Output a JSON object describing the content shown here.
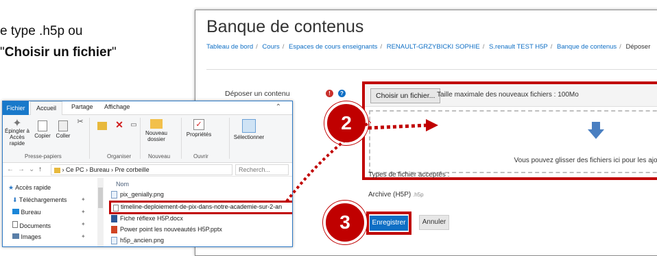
{
  "instructions": {
    "line1": "e type .h5p ou",
    "line2_prefix": "\"",
    "line2_bold": "Choisir un fichier",
    "line2_suffix": "\""
  },
  "moodle": {
    "title": "Banque de contenus",
    "breadcrumb": [
      "Tableau de bord",
      "Cours",
      "Espaces de cours enseignants",
      "RENAULT-GRZYBICKI SOPHIE",
      "S.renault TEST H5P",
      "Banque de contenus",
      "Déposer"
    ],
    "form_label": "Déposer un contenu",
    "choose_button": "Choisir un fichier...",
    "max_size": "Taille maximale des nouveaux fichiers : 100Mo",
    "drop_text": "Vous pouvez glisser des fichiers ici pour les ajouter.",
    "accepted_types_label": "Types de fichier acceptés :",
    "accepted_type": "Archive (H5P)",
    "accepted_ext": ".h5p",
    "save_button": "Enregistrer",
    "cancel_button": "Annuler"
  },
  "badges": {
    "step2": "2",
    "step3": "3"
  },
  "explorer": {
    "tabs": {
      "file": "Fichier",
      "home": "Accueil",
      "share": "Partage",
      "view": "Affichage"
    },
    "ribbon": {
      "pin": "Épingler à Accès rapide",
      "copy": "Copier",
      "paste": "Coller",
      "new_folder": "Nouveau dossier",
      "properties": "Propriétés",
      "select": "Sélectionner",
      "groups": {
        "clipboard": "Presse-papiers",
        "organize": "Organiser",
        "new": "Nouveau",
        "open": "Ouvrir"
      }
    },
    "address": [
      "Ce PC",
      "Bureau",
      "Pre corbeille"
    ],
    "search_placeholder": "Recherch...",
    "nav": [
      "Accès rapide",
      "Téléchargements",
      "Bureau",
      "Documents",
      "Images"
    ],
    "column_name": "Nom",
    "files": [
      "pix_genially.png",
      "timeline-deploiement-de-pix-dans-notre-academie-sur-2-an",
      "Fiche réflexe H5P.docx",
      "Power point les nouveautés H5P.pptx",
      "h5p_ancien.png"
    ]
  },
  "colors": {
    "highlight": "#c00000",
    "link": "#0f6fc5",
    "explorer_accent": "#1979ca"
  }
}
